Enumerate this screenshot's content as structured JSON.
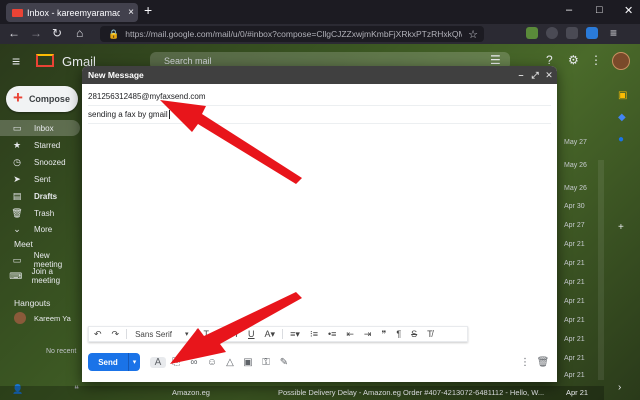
{
  "browser": {
    "tab_title": "Inbox - kareemyaramadan@gm",
    "tab_close": "×",
    "new_tab": "+",
    "url": "https://mail.google.com/mail/u/0/#inbox?compose=CllgCJZZxwjmKmbFjXRkxPTzRHxkQMSdzDXWBRHn",
    "window_controls": [
      "–",
      "□",
      "✕"
    ],
    "nav_icons": [
      "arrow-left-icon",
      "arrow-right-icon",
      "reload-icon"
    ]
  },
  "gmail": {
    "app_name": "Gmail",
    "search_placeholder": "Search mail",
    "compose_label": "Compose",
    "nav": [
      {
        "label": "Inbox",
        "icon": "inbox-icon",
        "glyph": "▭"
      },
      {
        "label": "Starred",
        "icon": "star-icon",
        "glyph": "★"
      },
      {
        "label": "Snoozed",
        "icon": "clock-icon",
        "glyph": "◷"
      },
      {
        "label": "Sent",
        "icon": "send-icon",
        "glyph": "➤"
      },
      {
        "label": "Drafts",
        "icon": "draft-icon",
        "glyph": "▤"
      },
      {
        "label": "Trash",
        "icon": "trash-icon",
        "glyph": "🗑"
      },
      {
        "label": "More",
        "icon": "chevron-down-icon",
        "glyph": "⌄"
      }
    ],
    "meet_header": "Meet",
    "meet_items": [
      "New meeting",
      "Join a meeting"
    ],
    "hangouts_header": "Hangouts",
    "hangouts_user": "Kareem Ya",
    "hangouts_empty": "No recent",
    "dates": [
      "May 27",
      "May 26",
      "May 26",
      "Apr 30",
      "Apr 27",
      "Apr 21",
      "Apr 21",
      "Apr 21",
      "Apr 21",
      "Apr 21",
      "Apr 21",
      "Apr 21",
      "Apr 21"
    ],
    "bottom_email": {
      "sender": "Amazon.eg",
      "subject": "Possible Delivery Delay - Amazon.eg Order #407-4213072-6481112 - Hello, W...",
      "date": "Apr 21"
    }
  },
  "compose": {
    "title": "New Message",
    "to": "281256312485@myfaxsend.com",
    "subject": "sending a fax by gmail",
    "font": "Sans Serif",
    "send_label": "Send",
    "head_icons": [
      "minimize-icon",
      "expand-icon",
      "close-icon"
    ]
  },
  "colors": {
    "accent": "#1a73e8",
    "arrow": "#e8151b",
    "header": "#404040"
  }
}
